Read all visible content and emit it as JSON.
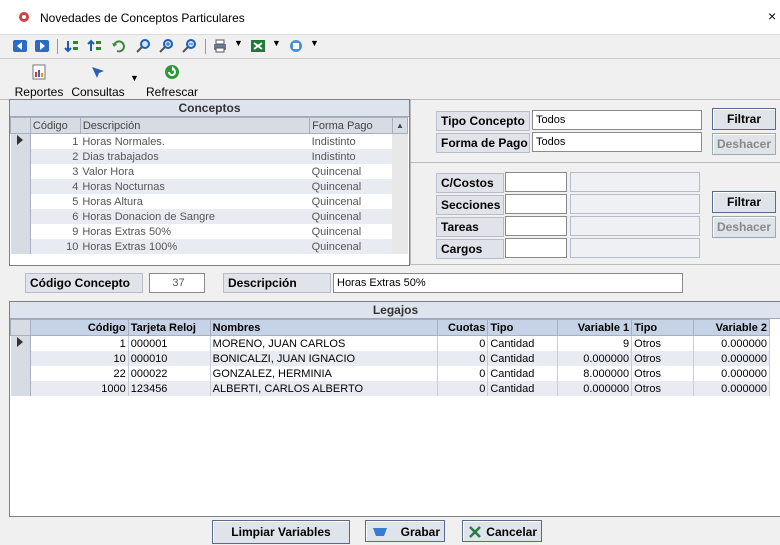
{
  "window": {
    "title": "Novedades de Conceptos Particulares",
    "close_glyph": "×"
  },
  "toolbar": {
    "icons": [
      "back-icon",
      "forward-icon",
      "sort-asc-icon",
      "sort-desc-icon",
      "undo-icon",
      "search-icon",
      "zoom-in-icon",
      "zoom-out-icon",
      "print-icon",
      "excel-icon",
      "export-icon"
    ]
  },
  "actions": {
    "reportes": "Reportes",
    "consultas": "Consultas",
    "refrescar": "Refrescar"
  },
  "conceptos": {
    "header": "Conceptos",
    "columns": [
      "Código",
      "Descripción",
      "Forma Pago"
    ],
    "rows": [
      {
        "codigo": "1",
        "descripcion": "Horas Normales.",
        "forma": "Indistinto"
      },
      {
        "codigo": "2",
        "descripcion": "Dias trabajados",
        "forma": "Indistinto"
      },
      {
        "codigo": "3",
        "descripcion": "Valor Hora",
        "forma": "Quincenal"
      },
      {
        "codigo": "4",
        "descripcion": "Horas Nocturnas",
        "forma": "Quincenal"
      },
      {
        "codigo": "5",
        "descripcion": "Horas Altura",
        "forma": "Quincenal"
      },
      {
        "codigo": "6",
        "descripcion": "Horas Donacion de Sangre",
        "forma": "Quincenal"
      },
      {
        "codigo": "9",
        "descripcion": "Horas Extras 50%",
        "forma": "Quincenal"
      },
      {
        "codigo": "10",
        "descripcion": "Horas Extras 100%",
        "forma": "Quincenal"
      }
    ]
  },
  "filtros": {
    "tipo_concepto_label": "Tipo Concepto",
    "tipo_concepto_value": "Todos",
    "forma_pago_label": "Forma de Pago",
    "forma_pago_value": "Todos",
    "filtrar": "Filtrar",
    "deshacer": "Deshacer",
    "ccostos": "C/Costos",
    "secciones": "Secciones",
    "tareas": "Tareas",
    "cargos": "Cargos"
  },
  "concepto_sel": {
    "codigo_label": "Código Concepto",
    "codigo_value": "37",
    "descripcion_label": "Descripción",
    "descripcion_value": "Horas Extras 50%"
  },
  "legajos": {
    "header": "Legajos",
    "columns": [
      "Código",
      "Tarjeta Reloj",
      "Nombres",
      "Cuotas",
      "Tipo",
      "Variable 1",
      "Tipo",
      "Variable 2"
    ],
    "rows": [
      {
        "codigo": "1",
        "tarjeta": "000001",
        "nombre": "MORENO, JUAN CARLOS",
        "cuotas": "0",
        "tipo1": "Cantidad",
        "var1": "9",
        "tipo2": "Otros",
        "var2": "0.000000"
      },
      {
        "codigo": "10",
        "tarjeta": "000010",
        "nombre": "BONICALZI, JUAN IGNACIO",
        "cuotas": "0",
        "tipo1": "Cantidad",
        "var1": "0.000000",
        "tipo2": "Otros",
        "var2": "0.000000"
      },
      {
        "codigo": "22",
        "tarjeta": "000022",
        "nombre": "GONZALEZ, HERMINIA",
        "cuotas": "0",
        "tipo1": "Cantidad",
        "var1": "8.000000",
        "tipo2": "Otros",
        "var2": "0.000000"
      },
      {
        "codigo": "1000",
        "tarjeta": "123456",
        "nombre": "ALBERTI, CARLOS ALBERTO",
        "cuotas": "0",
        "tipo1": "Cantidad",
        "var1": "0.000000",
        "tipo2": "Otros",
        "var2": "0.000000"
      }
    ]
  },
  "footer": {
    "limpiar": "Limpiar Variables",
    "grabar": "Grabar",
    "cancelar": "Cancelar"
  }
}
